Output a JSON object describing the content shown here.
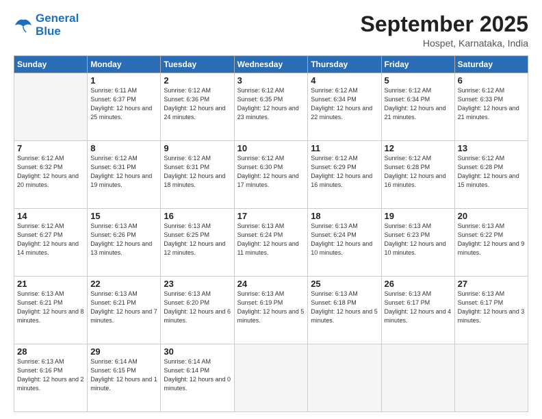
{
  "logo": {
    "line1": "General",
    "line2": "Blue"
  },
  "header": {
    "title": "September 2025",
    "subtitle": "Hospet, Karnataka, India"
  },
  "days_of_week": [
    "Sunday",
    "Monday",
    "Tuesday",
    "Wednesday",
    "Thursday",
    "Friday",
    "Saturday"
  ],
  "weeks": [
    [
      {
        "day": "",
        "sunrise": "",
        "sunset": "",
        "daylight": ""
      },
      {
        "day": "1",
        "sunrise": "Sunrise: 6:11 AM",
        "sunset": "Sunset: 6:37 PM",
        "daylight": "Daylight: 12 hours and 25 minutes."
      },
      {
        "day": "2",
        "sunrise": "Sunrise: 6:12 AM",
        "sunset": "Sunset: 6:36 PM",
        "daylight": "Daylight: 12 hours and 24 minutes."
      },
      {
        "day": "3",
        "sunrise": "Sunrise: 6:12 AM",
        "sunset": "Sunset: 6:35 PM",
        "daylight": "Daylight: 12 hours and 23 minutes."
      },
      {
        "day": "4",
        "sunrise": "Sunrise: 6:12 AM",
        "sunset": "Sunset: 6:34 PM",
        "daylight": "Daylight: 12 hours and 22 minutes."
      },
      {
        "day": "5",
        "sunrise": "Sunrise: 6:12 AM",
        "sunset": "Sunset: 6:34 PM",
        "daylight": "Daylight: 12 hours and 21 minutes."
      },
      {
        "day": "6",
        "sunrise": "Sunrise: 6:12 AM",
        "sunset": "Sunset: 6:33 PM",
        "daylight": "Daylight: 12 hours and 21 minutes."
      }
    ],
    [
      {
        "day": "7",
        "sunrise": "Sunrise: 6:12 AM",
        "sunset": "Sunset: 6:32 PM",
        "daylight": "Daylight: 12 hours and 20 minutes."
      },
      {
        "day": "8",
        "sunrise": "Sunrise: 6:12 AM",
        "sunset": "Sunset: 6:31 PM",
        "daylight": "Daylight: 12 hours and 19 minutes."
      },
      {
        "day": "9",
        "sunrise": "Sunrise: 6:12 AM",
        "sunset": "Sunset: 6:31 PM",
        "daylight": "Daylight: 12 hours and 18 minutes."
      },
      {
        "day": "10",
        "sunrise": "Sunrise: 6:12 AM",
        "sunset": "Sunset: 6:30 PM",
        "daylight": "Daylight: 12 hours and 17 minutes."
      },
      {
        "day": "11",
        "sunrise": "Sunrise: 6:12 AM",
        "sunset": "Sunset: 6:29 PM",
        "daylight": "Daylight: 12 hours and 16 minutes."
      },
      {
        "day": "12",
        "sunrise": "Sunrise: 6:12 AM",
        "sunset": "Sunset: 6:28 PM",
        "daylight": "Daylight: 12 hours and 16 minutes."
      },
      {
        "day": "13",
        "sunrise": "Sunrise: 6:12 AM",
        "sunset": "Sunset: 6:28 PM",
        "daylight": "Daylight: 12 hours and 15 minutes."
      }
    ],
    [
      {
        "day": "14",
        "sunrise": "Sunrise: 6:12 AM",
        "sunset": "Sunset: 6:27 PM",
        "daylight": "Daylight: 12 hours and 14 minutes."
      },
      {
        "day": "15",
        "sunrise": "Sunrise: 6:13 AM",
        "sunset": "Sunset: 6:26 PM",
        "daylight": "Daylight: 12 hours and 13 minutes."
      },
      {
        "day": "16",
        "sunrise": "Sunrise: 6:13 AM",
        "sunset": "Sunset: 6:25 PM",
        "daylight": "Daylight: 12 hours and 12 minutes."
      },
      {
        "day": "17",
        "sunrise": "Sunrise: 6:13 AM",
        "sunset": "Sunset: 6:24 PM",
        "daylight": "Daylight: 12 hours and 11 minutes."
      },
      {
        "day": "18",
        "sunrise": "Sunrise: 6:13 AM",
        "sunset": "Sunset: 6:24 PM",
        "daylight": "Daylight: 12 hours and 10 minutes."
      },
      {
        "day": "19",
        "sunrise": "Sunrise: 6:13 AM",
        "sunset": "Sunset: 6:23 PM",
        "daylight": "Daylight: 12 hours and 10 minutes."
      },
      {
        "day": "20",
        "sunrise": "Sunrise: 6:13 AM",
        "sunset": "Sunset: 6:22 PM",
        "daylight": "Daylight: 12 hours and 9 minutes."
      }
    ],
    [
      {
        "day": "21",
        "sunrise": "Sunrise: 6:13 AM",
        "sunset": "Sunset: 6:21 PM",
        "daylight": "Daylight: 12 hours and 8 minutes."
      },
      {
        "day": "22",
        "sunrise": "Sunrise: 6:13 AM",
        "sunset": "Sunset: 6:21 PM",
        "daylight": "Daylight: 12 hours and 7 minutes."
      },
      {
        "day": "23",
        "sunrise": "Sunrise: 6:13 AM",
        "sunset": "Sunset: 6:20 PM",
        "daylight": "Daylight: 12 hours and 6 minutes."
      },
      {
        "day": "24",
        "sunrise": "Sunrise: 6:13 AM",
        "sunset": "Sunset: 6:19 PM",
        "daylight": "Daylight: 12 hours and 5 minutes."
      },
      {
        "day": "25",
        "sunrise": "Sunrise: 6:13 AM",
        "sunset": "Sunset: 6:18 PM",
        "daylight": "Daylight: 12 hours and 5 minutes."
      },
      {
        "day": "26",
        "sunrise": "Sunrise: 6:13 AM",
        "sunset": "Sunset: 6:17 PM",
        "daylight": "Daylight: 12 hours and 4 minutes."
      },
      {
        "day": "27",
        "sunrise": "Sunrise: 6:13 AM",
        "sunset": "Sunset: 6:17 PM",
        "daylight": "Daylight: 12 hours and 3 minutes."
      }
    ],
    [
      {
        "day": "28",
        "sunrise": "Sunrise: 6:13 AM",
        "sunset": "Sunset: 6:16 PM",
        "daylight": "Daylight: 12 hours and 2 minutes."
      },
      {
        "day": "29",
        "sunrise": "Sunrise: 6:14 AM",
        "sunset": "Sunset: 6:15 PM",
        "daylight": "Daylight: 12 hours and 1 minute."
      },
      {
        "day": "30",
        "sunrise": "Sunrise: 6:14 AM",
        "sunset": "Sunset: 6:14 PM",
        "daylight": "Daylight: 12 hours and 0 minutes."
      },
      {
        "day": "",
        "sunrise": "",
        "sunset": "",
        "daylight": ""
      },
      {
        "day": "",
        "sunrise": "",
        "sunset": "",
        "daylight": ""
      },
      {
        "day": "",
        "sunrise": "",
        "sunset": "",
        "daylight": ""
      },
      {
        "day": "",
        "sunrise": "",
        "sunset": "",
        "daylight": ""
      }
    ]
  ]
}
